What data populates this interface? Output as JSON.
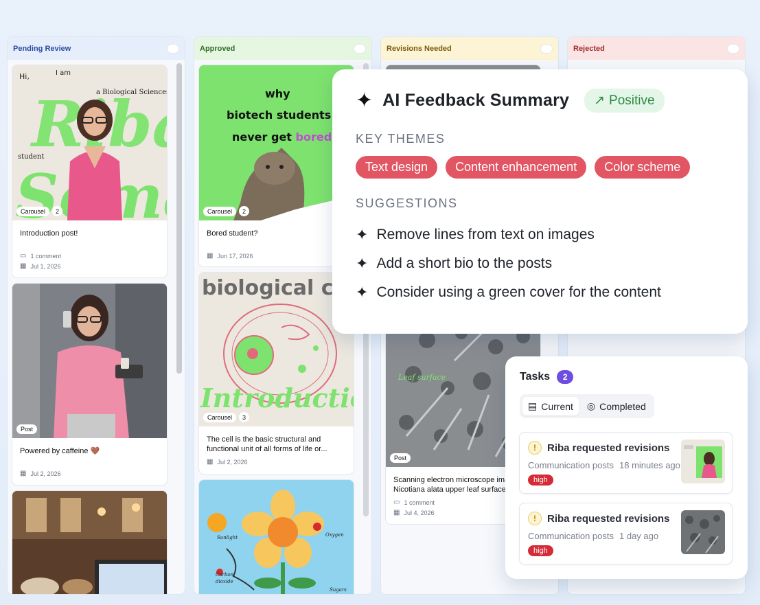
{
  "columns": [
    {
      "label": "Pending Review"
    },
    {
      "label": "Approved"
    },
    {
      "label": "Revisions Needed"
    },
    {
      "label": "Rejected"
    }
  ],
  "pending": [
    {
      "type": "Carousel",
      "count": "2",
      "title": "Introduction post!",
      "comments": "1 comment",
      "date": "Jul 1, 2026",
      "art": {
        "hi": "Hi,",
        "iam": "I am",
        "name1": "Riba",
        "name2": "Soma",
        "tag": "a Biological Sciences",
        "student": "student"
      }
    },
    {
      "type": "Post",
      "title": "Powered by caffeine 🤎",
      "date": "Jul 2, 2026"
    }
  ],
  "approved": [
    {
      "type": "Carousel",
      "count": "2",
      "title": "Bored student?",
      "date": "Jun 17, 2026",
      "art": {
        "line1": "why",
        "line2": "biotech  students",
        "line3a": "never get ",
        "line3b": "bored"
      }
    },
    {
      "type": "Carousel",
      "count": "3",
      "title": "The cell is the basic structural and functional unit of all forms of life or...",
      "date": "Jul 2, 2026",
      "art": {
        "head": "biological ce",
        "script": "Introduction"
      }
    },
    {
      "art": {
        "sun": "Sunlight",
        "o2": "Oxygen",
        "co2a": "Carbon",
        "co2b": "dioxide",
        "sugar": "Sugars"
      }
    }
  ],
  "revisions": [
    {
      "type": "Post",
      "title": "Scanning electron microscope image of Nicotiana alata upper leaf surface, ...",
      "comments": "1 comment",
      "date": "Jul 4, 2026",
      "art": {
        "caption": "Leaf surface"
      }
    }
  ],
  "ai": {
    "title": "AI Feedback Summary",
    "sentiment": "Positive",
    "themes_label": "KEY THEMES",
    "themes": [
      "Text design",
      "Content enhancement",
      "Color scheme"
    ],
    "suggestions_label": "SUGGESTIONS",
    "suggestions": [
      "Remove lines from text on images",
      "Add a short bio to the posts",
      "Consider using a green cover for the content"
    ]
  },
  "tasks": {
    "title": "Tasks",
    "count": "2",
    "tabs": [
      "Current",
      "Completed"
    ],
    "items": [
      {
        "title": "Riba requested revisions",
        "channel": "Communication posts",
        "time": "18 minutes ago",
        "priority": "high"
      },
      {
        "title": "Riba requested revisions",
        "channel": "Communication posts",
        "time": "1 day ago",
        "priority": "high"
      }
    ]
  },
  "colors": {
    "accent": "#6d4ee0",
    "theme_pill": "#e25563",
    "priority": "#d42b37",
    "green_art": "#7ee36e"
  }
}
